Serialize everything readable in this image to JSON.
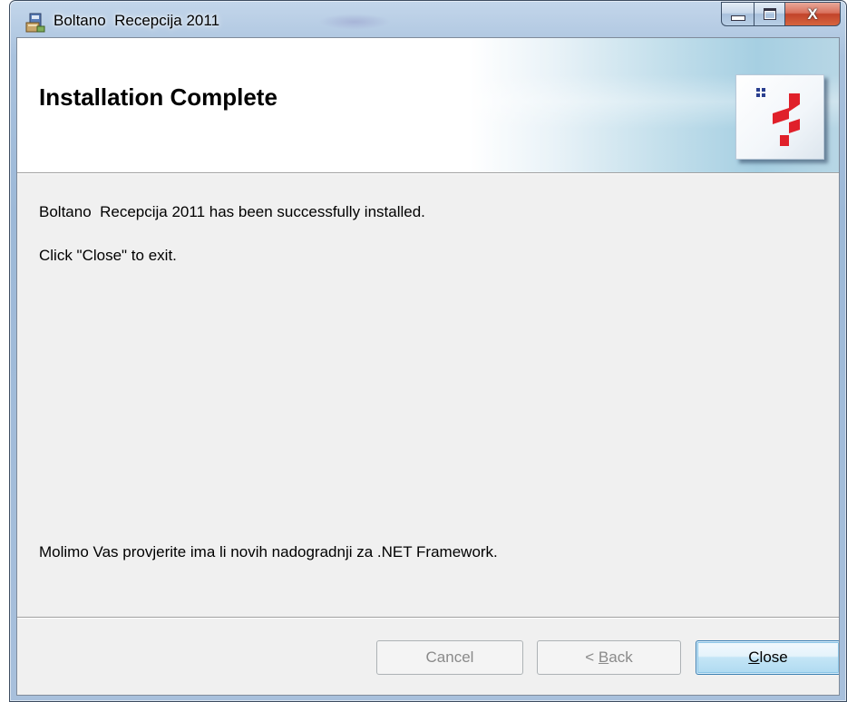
{
  "window": {
    "title": "Boltano  Recepcija 2011",
    "caption_buttons": {
      "minimize_icon": "minimize-icon",
      "maximize_icon": "maximize-icon",
      "close_glyph": "X"
    }
  },
  "banner": {
    "title": "Installation Complete",
    "logo": "boltano-logo"
  },
  "body": {
    "line1": "Boltano  Recepcija 2011 has been successfully installed.",
    "line2": "Click \"Close\" to exit.",
    "note": "Molimo Vas provjerite ima li novih nadogradnji za .NET Framework."
  },
  "buttons": {
    "cancel": {
      "label": "Cancel",
      "enabled": false
    },
    "back": {
      "prefix": "< ",
      "accel": "B",
      "rest": "ack",
      "enabled": false
    },
    "close": {
      "accel": "C",
      "rest": "lose",
      "enabled": true,
      "default": true
    }
  },
  "colors": {
    "logo_red": "#e0202a",
    "logo_blue": "#2a3f8f",
    "close_button_red": "#c2432a"
  }
}
